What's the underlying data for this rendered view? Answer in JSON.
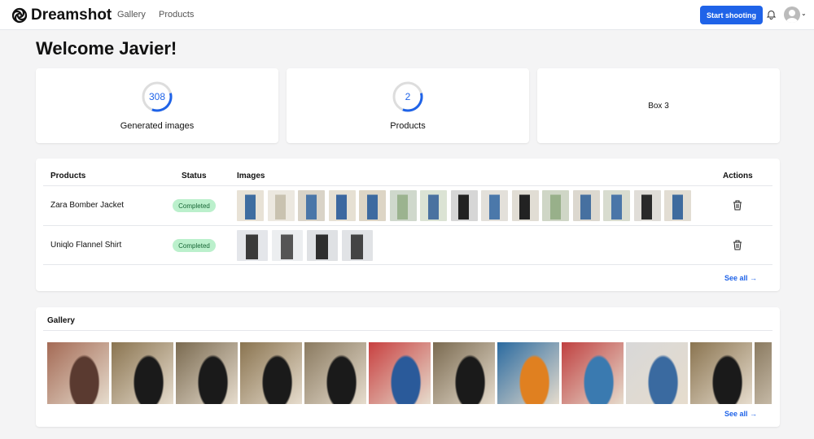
{
  "nav": {
    "brand": "Dreamshot",
    "links": [
      "Gallery",
      "Products"
    ],
    "cta": "Start shooting"
  },
  "welcome": "Welcome Javier!",
  "stats": [
    {
      "value": "308",
      "label": "Generated images",
      "ring_fill": 0.35
    },
    {
      "value": "2",
      "label": "Products",
      "ring_fill": 0.35
    },
    {
      "label": "Box 3"
    }
  ],
  "products": {
    "headers": [
      "Products",
      "Status",
      "Images",
      "Actions"
    ],
    "rows": [
      {
        "name": "Zara Bomber Jacket",
        "status": "Completed",
        "image_count": 15
      },
      {
        "name": "Uniqlo Flannel Shirt",
        "status": "Completed",
        "image_count": 4
      }
    ],
    "see_all": "See all →"
  },
  "gallery": {
    "title": "Gallery",
    "image_count": 12,
    "see_all": "See all →"
  },
  "colors": {
    "accent": "#1f63e8",
    "badge": "#bbf0cc"
  }
}
